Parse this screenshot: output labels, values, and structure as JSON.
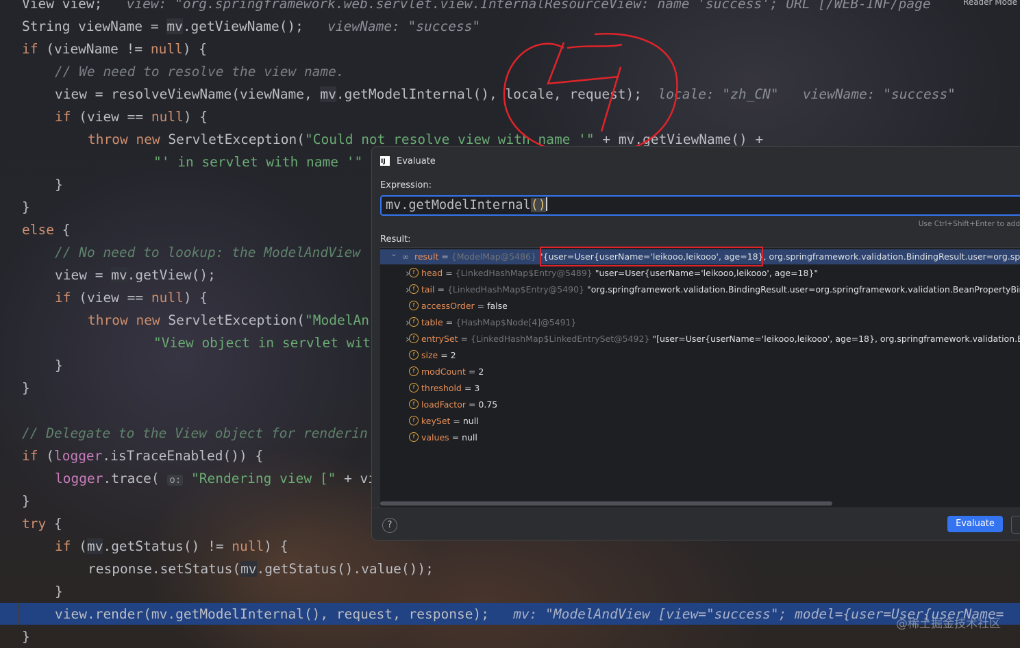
{
  "editor": {
    "reader_mode": "Reader Mode",
    "watermark": "@稀土掘金技术社区",
    "lines": {
      "l0_code": "View view;",
      "l0_hint": "view: \"org.springframework.web.servlet.view.InternalResourceView: name 'success'; URL [/WEB-INF/page",
      "l1_a": "String viewName = ",
      "l1_b": "mv",
      "l1_c": ".getViewName();",
      "l1_hint": "viewName: \"success\"",
      "l2_kw": "if",
      "l2_a": " (viewName != ",
      "l2_null": "null",
      "l2_b": ") {",
      "l3": "// We need to resolve the view name.",
      "l4_a": "view = resolveViewName(viewName, ",
      "l4_b": "mv",
      "l4_c": ".getModelInternal(), locale, request);",
      "l4_hint1": "locale: \"zh_CN\"",
      "l4_hint2": "viewName: \"success\"",
      "l5_kw": "if",
      "l5_a": " (view == ",
      "l5_null": "null",
      "l5_b": ") {",
      "l6_kw1": "throw",
      "l6_kw2": "new",
      "l6_a": " ServletException(",
      "l6_str": "\"Could not resolve view with name '\"",
      "l6_b": " + ",
      "l6_c": "mv",
      "l6_d": ".getViewName() +",
      "l7_str": "\"' in servlet with name '\"",
      "l8": "}",
      "l9": "}",
      "l10_kw": "else",
      "l10_a": " {",
      "l11": "// No need to lookup: the ModelAndView",
      "l12_a": "view = ",
      "l12_b": "mv",
      "l12_c": ".getView();",
      "l13_kw": "if",
      "l13_a": " (view == ",
      "l13_null": "null",
      "l13_b": ") {",
      "l14_kw1": "throw",
      "l14_kw2": "new",
      "l14_a": " ServletException(",
      "l14_str": "\"ModelAn",
      "l15_str": "\"View object in servlet wit",
      "l16": "}",
      "l17": "}",
      "l18": "// Delegate to the View object for renderin",
      "l19_kw": "if",
      "l19_a": " (",
      "l19_fld": "logger",
      "l19_b": ".isTraceEnabled()) {",
      "l20_fld": "logger",
      "l20_a": ".trace(",
      "l20_param": "o:",
      "l20_str": "\"Rendering view [\"",
      "l20_b": " + vi",
      "l21": "}",
      "l22_kw": "try",
      "l22_a": " {",
      "l23_kw": "if",
      "l23_a": " (",
      "l23_b": "mv",
      "l23_c": ".getStatus() != ",
      "l23_null": "null",
      "l23_d": ") {",
      "l24_a": "response.setStatus(",
      "l24_b": "mv",
      "l24_c": ".getStatus().value());",
      "l25": "}",
      "l26_code": "view.render(mv.getModelInternal(), request, response);",
      "l26_hint": "mv: \"ModelAndView [view=\"success\"; model={user=User{userName=",
      "l27": "}"
    }
  },
  "dialog": {
    "title": "Evaluate",
    "expression_label": "Expression:",
    "expression_text": "mv.getModelInternal",
    "expression_parens": "()",
    "hint": "Use Ctrl+Shift+Enter to add",
    "result_label": "Result:",
    "help": "?",
    "evaluate_button": "Evaluate",
    "result_rows": [
      {
        "name": "result",
        "ref": "{ModelMap@5486}",
        "value": "\"{user=User{userName='leikooo,leikooo', age=18}, org.springframework.validation.BindingResult.user=org.spring"
      },
      {
        "name": "head",
        "ref": "{LinkedHashMap$Entry@5489}",
        "value": "\"user=User{userName='leikooo,leikooo', age=18}\""
      },
      {
        "name": "tail",
        "ref": "{LinkedHashMap$Entry@5490}",
        "value": "\"org.springframework.validation.BindingResult.user=org.springframework.validation.BeanPropertyBin"
      },
      {
        "name": "accessOrder",
        "ref": "",
        "value": "false"
      },
      {
        "name": "table",
        "ref": "{HashMap$Node[4]@5491}",
        "value": ""
      },
      {
        "name": "entrySet",
        "ref": "{LinkedHashMap$LinkedEntrySet@5492}",
        "value": "\"[user=User{userName='leikooo,leikooo', age=18}, org.springframework.validation.Bi"
      },
      {
        "name": "size",
        "ref": "",
        "value": "2"
      },
      {
        "name": "modCount",
        "ref": "",
        "value": "2"
      },
      {
        "name": "threshold",
        "ref": "",
        "value": "3"
      },
      {
        "name": "loadFactor",
        "ref": "",
        "value": "0.75"
      },
      {
        "name": "keySet",
        "ref": "",
        "value": "null"
      },
      {
        "name": "values",
        "ref": "",
        "value": "null"
      }
    ]
  },
  "colors": {
    "accent": "#3574f0",
    "annotation": "#e0242a",
    "execution_line": "#214283"
  }
}
